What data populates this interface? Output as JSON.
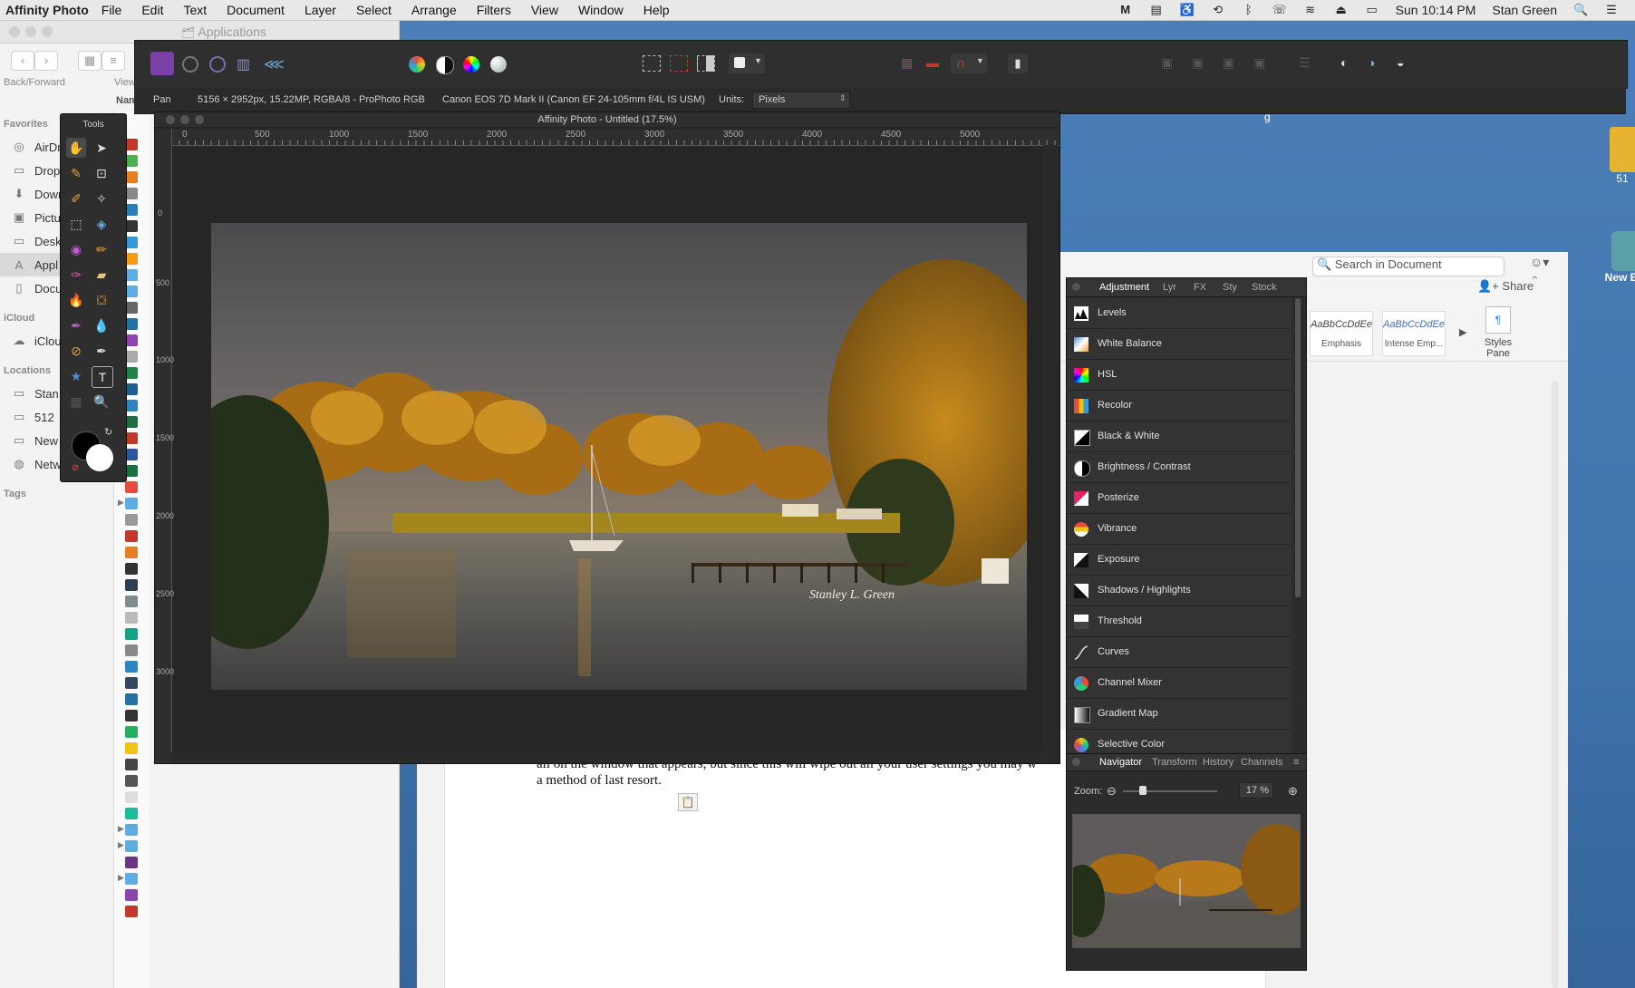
{
  "menubar": {
    "app_name": "Affinity Photo",
    "items": [
      "File",
      "Edit",
      "Text",
      "Document",
      "Layer",
      "Select",
      "Arrange",
      "Filters",
      "View",
      "Window",
      "Help"
    ],
    "clock": "Sun 10:14 PM",
    "user": "Stan Green"
  },
  "finder": {
    "title": "Applications",
    "back_forward_label": "Back/Forward",
    "view_label": "View",
    "name_header": "Nam",
    "favorites_header": "Favorites",
    "favorites": [
      "AirDr",
      "Drop",
      "Dowr",
      "Pictu",
      "Deskt",
      "Appl",
      "Docu"
    ],
    "icloud_header": "iCloud",
    "icloud": [
      "iClou"
    ],
    "locations_header": "Locations",
    "locations": [
      "Stan",
      "512",
      "New",
      "Netw"
    ],
    "tags_header": "Tags"
  },
  "affinity": {
    "context": {
      "tool": "Pan",
      "doc_info": "5156 × 2952px, 15.22MP, RGBA/8 - ProPhoto RGB",
      "camera": "Canon EOS 7D Mark II (Canon EF 24-105mm f/4L IS USM)",
      "units_label": "Units:",
      "units_value": "Pixels"
    },
    "doc_title": "Affinity Photo - Untitled (17.5%)",
    "ruler_unit": "px",
    "ruler_h": [
      "0",
      "500",
      "1000",
      "1500",
      "2000",
      "2500",
      "3000",
      "3500",
      "4000",
      "4500",
      "5000"
    ],
    "ruler_v": [
      "0",
      "500",
      "1000",
      "1500",
      "2000",
      "2500",
      "3000"
    ],
    "photo_signature": "Stanley L. Green",
    "tools_title": "Tools"
  },
  "adjustment_panel": {
    "tabs": [
      "Adjustment",
      "Lyr",
      "FX",
      "Sty",
      "Stock"
    ],
    "items": [
      "Levels",
      "White Balance",
      "HSL",
      "Recolor",
      "Black & White",
      "Brightness / Contrast",
      "Posterize",
      "Vibrance",
      "Exposure",
      "Shadows / Highlights",
      "Threshold",
      "Curves",
      "Channel Mixer",
      "Gradient Map",
      "Selective Color"
    ]
  },
  "navigator_panel": {
    "tabs": [
      "Navigator",
      "Transform",
      "History",
      "Channels"
    ],
    "zoom_label": "Zoom:",
    "zoom_value": "17 %",
    "zoom_fraction": 0.17
  },
  "word": {
    "search_placeholder": "Search in Document",
    "share_label": "Share",
    "style1_sample": "AaBbCcDdEe",
    "style1_name": "Emphasis",
    "style2_sample": "AaBbCcDdEe",
    "style2_name": "Intense Emp...",
    "styles_pane_label_1": "Styles",
    "styles_pane_label_2": "Pane",
    "doc_text_line1": "all on the window that appears, but since this will wipe out all your user settings you may w",
    "doc_text_line2": "a method of last resort."
  },
  "desktop": {
    "icon1_label": "51",
    "icon2_label": "New B",
    "stray_label": "g"
  },
  "colors": {
    "desktop": "#3f74ad",
    "affinity_panel": "#2c2c2c",
    "affinity_accent": "#a34bd6"
  }
}
